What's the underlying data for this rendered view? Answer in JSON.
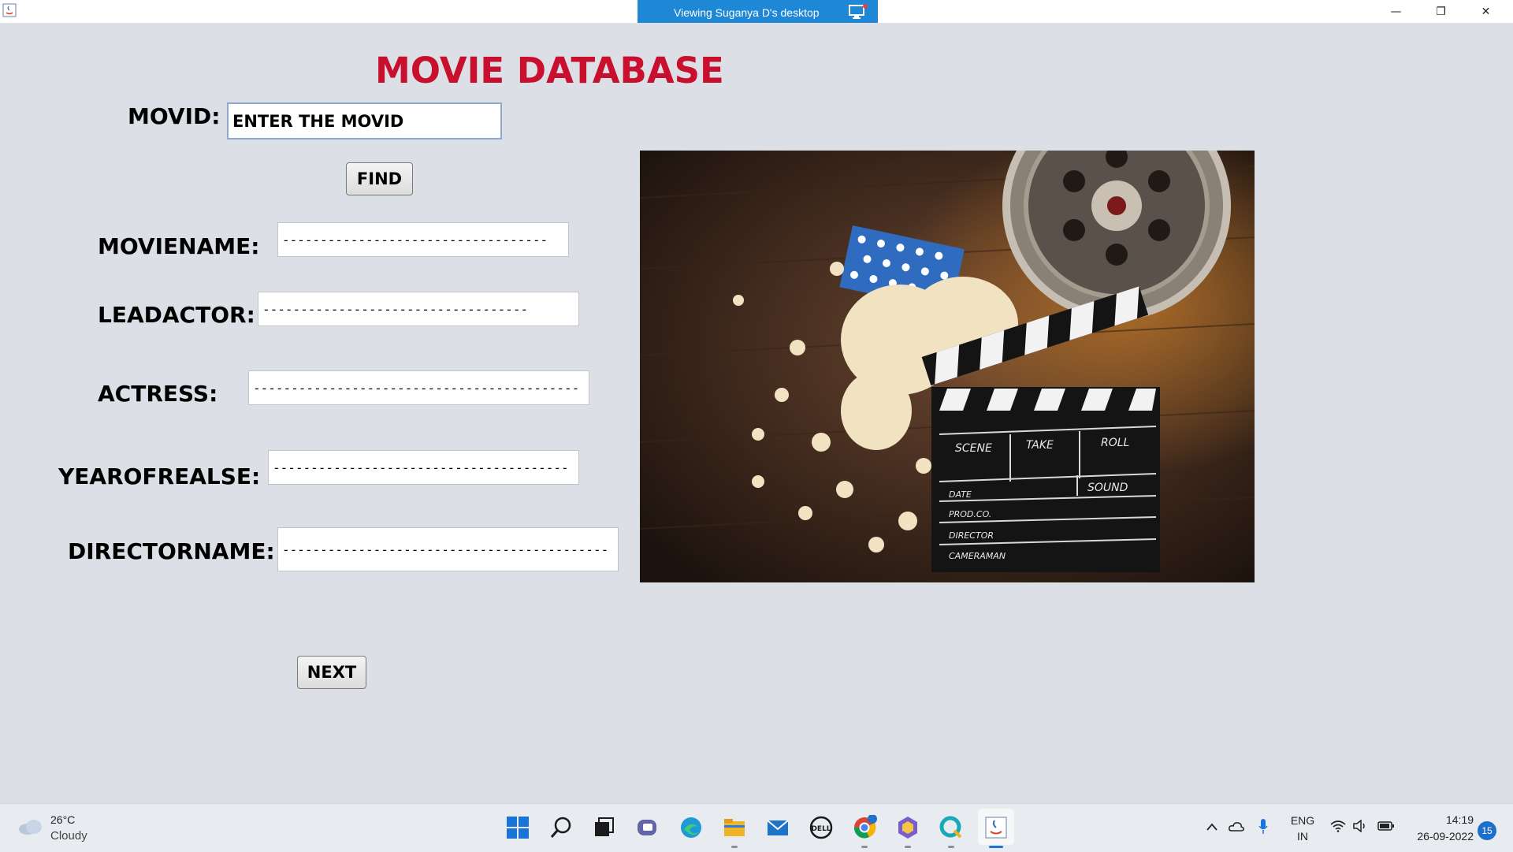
{
  "remote_banner": {
    "text": "Viewing Suganya D's desktop"
  },
  "window": {
    "minimize": "—",
    "restore": "❐",
    "close": "✕"
  },
  "app": {
    "title": "MOVIE DATABASE",
    "movid_label": "MOVID:",
    "movid_value": "ENTER THE MOVID",
    "find_button": "FIND",
    "fields": [
      {
        "label": "MOVIENAME:",
        "value": "-----------------------------------"
      },
      {
        "label": "LEADACTOR:",
        "value": "-----------------------------------"
      },
      {
        "label": "ACTRESS:",
        "value": "-------------------------------------------"
      },
      {
        "label": "YEAROFREALSE:",
        "value": "---------------------------------------"
      },
      {
        "label": "DIRECTORNAME:",
        "value": "-------------------------------------------"
      }
    ],
    "next_button": "NEXT",
    "image": {
      "slate_labels": [
        "SCENE",
        "TAKE",
        "ROLL",
        "SOUND",
        "DATE",
        "PROD.CO.",
        "DIRECTOR",
        "CAMERAMAN"
      ]
    }
  },
  "taskbar": {
    "weather_temp": "26°C",
    "weather_desc": "Cloudy",
    "icons": [
      "windows-start-icon",
      "search-icon",
      "task-view-icon",
      "teams-chat-icon",
      "edge-icon",
      "file-explorer-icon",
      "mail-icon",
      "dell-icon",
      "chrome-icon",
      "app-hexagon-icon",
      "browser-q-icon",
      "java-app-icon"
    ],
    "lang_top": "ENG",
    "lang_bottom": "IN",
    "time": "14:19",
    "date": "26-09-2022",
    "notifications": "15"
  }
}
